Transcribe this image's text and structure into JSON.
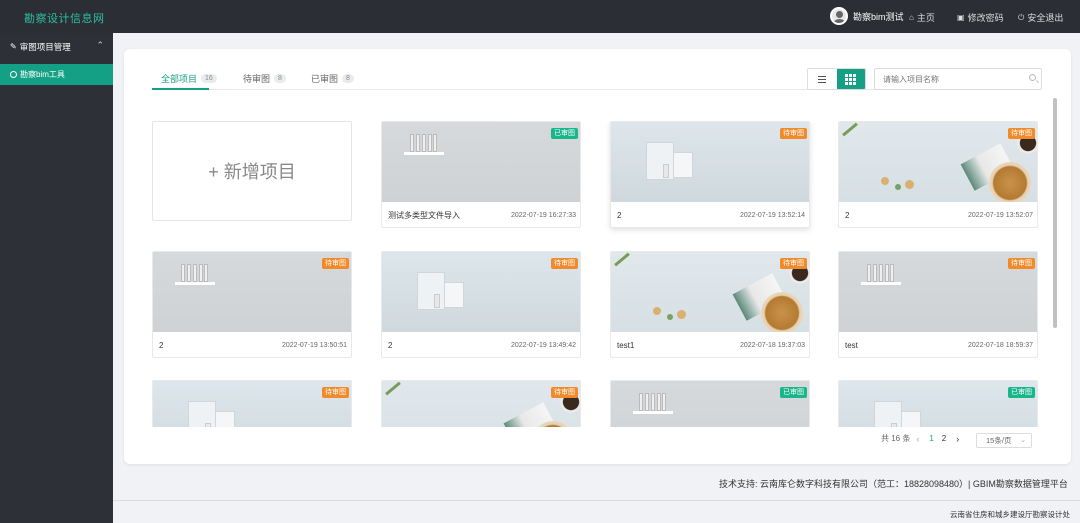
{
  "header": {
    "logo": "勘察设计信息网",
    "user_name": "勘察bim测试",
    "links": [
      {
        "icon": "home-icon",
        "glyph": "⌂",
        "label": "主页"
      },
      {
        "icon": "lock-icon",
        "glyph": "🔒",
        "label": "修改密码"
      },
      {
        "icon": "power-icon",
        "glyph": "⏻",
        "label": "安全退出"
      }
    ]
  },
  "sidebar": {
    "group_label": "审图项目管理",
    "group_icon": "edit-icon",
    "item_label": "勘察bim工具"
  },
  "tabs": [
    {
      "label": "全部项目",
      "count": "16"
    },
    {
      "label": "待审图",
      "count": "8"
    },
    {
      "label": "已审图",
      "count": "8"
    }
  ],
  "search": {
    "placeholder": "请输入项目名称"
  },
  "add_label": "+ 新增项目",
  "projects": [
    {
      "name": "测试多类型文件导入",
      "time": "2022-07-19 16:27:33",
      "status": "已审图",
      "thumb": "shelf"
    },
    {
      "name": "2",
      "time": "2022-07-19 13:52:14",
      "status": "待审图",
      "thumb": "box"
    },
    {
      "name": "2",
      "time": "2022-07-19 13:52:07",
      "status": "待审图",
      "thumb": "cafe"
    },
    {
      "name": "2",
      "time": "2022-07-19 13:50:51",
      "status": "待审图",
      "thumb": "shelf"
    },
    {
      "name": "2",
      "time": "2022-07-19 13:49:42",
      "status": "待审图",
      "thumb": "box"
    },
    {
      "name": "test1",
      "time": "2022-07-18 19:37:03",
      "status": "待审图",
      "thumb": "cafe"
    },
    {
      "name": "test",
      "time": "2022-07-18 18:59:37",
      "status": "待审图",
      "thumb": "shelf"
    },
    {
      "name": "",
      "time": "",
      "status": "待审图",
      "thumb": "box"
    },
    {
      "name": "",
      "time": "",
      "status": "待审图",
      "thumb": "cafe"
    },
    {
      "name": "",
      "time": "",
      "status": "已审图",
      "thumb": "shelf"
    },
    {
      "name": "",
      "time": "",
      "status": "已审图",
      "thumb": "box"
    }
  ],
  "pagination": {
    "total": "共 16 条",
    "pages": [
      "1",
      "2"
    ],
    "current": "1",
    "page_size": "15条/页"
  },
  "footer": {
    "support": "技术支持: 云南库仑数字科技有限公司（范工：18828098480）| GBIM勘察数据管理平台",
    "copyright": "云南省住房和城乡建设厅勘察设计处"
  },
  "colors": {
    "accent": "#14a085",
    "pending": "#f08a2a",
    "approved": "#19b58b"
  }
}
